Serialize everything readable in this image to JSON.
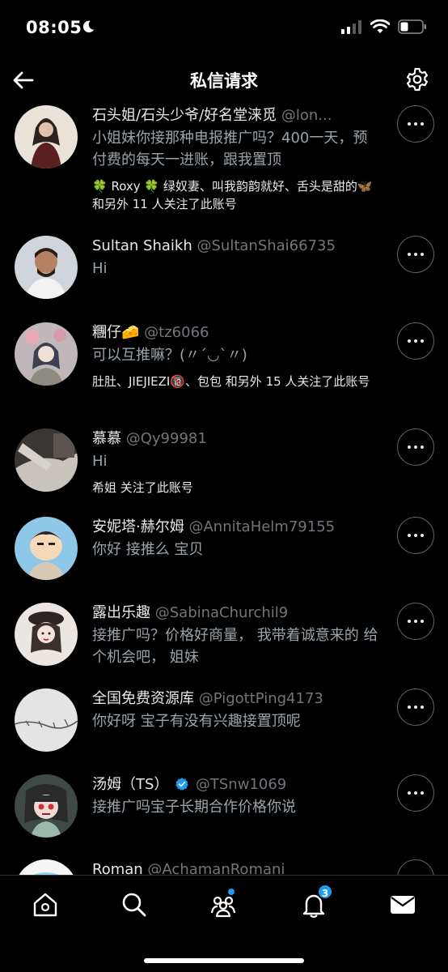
{
  "status_bar": {
    "time": "08:05"
  },
  "header": {
    "title": "私信请求"
  },
  "requests": [
    {
      "name": "石头姐/石头少爷/好名堂涞觅",
      "handle": "@lon...",
      "message": "小姐妹你接那种电报推广吗？400一天，预付费的每天一进账，跟我置顶",
      "followed": "🍀 Roxy 🍀 绿奴妻、叫我韵韵就好、舌头是甜的🦋 和另外 11 人关注了此账号"
    },
    {
      "name": "Sultan Shaikh",
      "handle": "@SultanShai66735",
      "message": "Hi",
      "followed": ""
    },
    {
      "name": "糰仔🧀",
      "handle": "@tz6066",
      "message": "可以互推嘛？(〃´◡`〃)",
      "followed": "肚肚、JIEJIEZI🔞、包包 和另外 15 人关注了此账号"
    },
    {
      "name": "慕慕",
      "handle": "@Qy99981",
      "message": "Hi",
      "followed": "希姐 关注了此账号"
    },
    {
      "name": "安妮塔·赫尔姆",
      "handle": "@AnnitaHelm79155",
      "message": "你好 接推么 宝贝",
      "followed": ""
    },
    {
      "name": "露出乐趣",
      "handle": "@SabinaChurchil9",
      "message": "接推广吗？价格好商量， 我带着诚意来的 给个机会吧， 姐妹",
      "followed": ""
    },
    {
      "name": "全国免费资源库",
      "handle": "@PigottPing4173",
      "message": "你好呀 宝子有没有兴趣接置顶呢",
      "followed": ""
    },
    {
      "name": "汤姆（TS）",
      "handle": "@TSnw1069",
      "message": "接推广吗宝子长期合作价格你说",
      "followed": "",
      "verified": true
    },
    {
      "name": "Roman",
      "handle": "@AchamanRomani",
      "message": "",
      "followed": ""
    }
  ],
  "bottom_nav": {
    "items": [
      "home-icon",
      "search-icon",
      "communities-icon",
      "notifications-icon",
      "messages-icon"
    ],
    "notifications_badge": "3"
  },
  "colors": {
    "accent": "#1d9bf0",
    "background": "#000000",
    "text": "#e7e9ea",
    "muted": "#71767b"
  }
}
